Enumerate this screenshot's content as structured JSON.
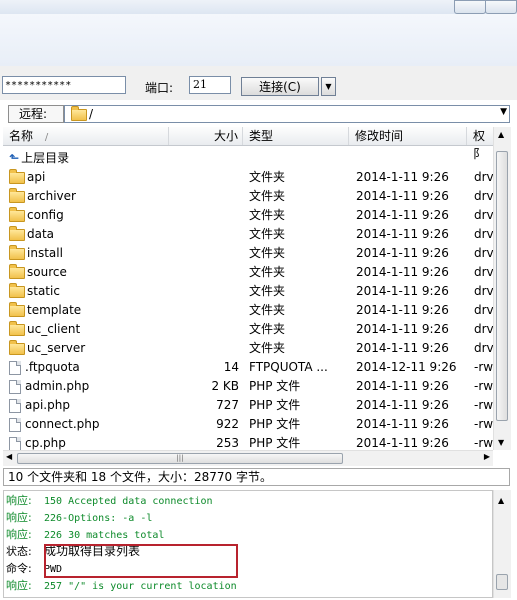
{
  "connection": {
    "password_mask": "***********",
    "port_label": "端口:",
    "port_value": "21",
    "connect_label": "连接(C)"
  },
  "remote": {
    "label": "远程:",
    "path": "/"
  },
  "columns": {
    "name": "名称",
    "size": "大小",
    "type": "类型",
    "modified": "修改时间",
    "perms": "权阝"
  },
  "rows": [
    {
      "name": "上层目录",
      "size": "",
      "type": "",
      "mod": "",
      "perm": "",
      "icon": "up-icon"
    },
    {
      "name": "api",
      "size": "",
      "type": "文件夹",
      "mod": "2014-1-11 9:26",
      "perm": "drv",
      "icon": "folder-icon"
    },
    {
      "name": "archiver",
      "size": "",
      "type": "文件夹",
      "mod": "2014-1-11 9:26",
      "perm": "drv",
      "icon": "folder-icon"
    },
    {
      "name": "config",
      "size": "",
      "type": "文件夹",
      "mod": "2014-1-11 9:26",
      "perm": "drv",
      "icon": "folder-icon"
    },
    {
      "name": "data",
      "size": "",
      "type": "文件夹",
      "mod": "2014-1-11 9:26",
      "perm": "drv",
      "icon": "folder-icon"
    },
    {
      "name": "install",
      "size": "",
      "type": "文件夹",
      "mod": "2014-1-11 9:26",
      "perm": "drv",
      "icon": "folder-icon"
    },
    {
      "name": "source",
      "size": "",
      "type": "文件夹",
      "mod": "2014-1-11 9:26",
      "perm": "drv",
      "icon": "folder-icon"
    },
    {
      "name": "static",
      "size": "",
      "type": "文件夹",
      "mod": "2014-1-11 9:26",
      "perm": "drv",
      "icon": "folder-icon"
    },
    {
      "name": "template",
      "size": "",
      "type": "文件夹",
      "mod": "2014-1-11 9:26",
      "perm": "drv",
      "icon": "folder-icon"
    },
    {
      "name": "uc_client",
      "size": "",
      "type": "文件夹",
      "mod": "2014-1-11 9:26",
      "perm": "drv",
      "icon": "folder-icon"
    },
    {
      "name": "uc_server",
      "size": "",
      "type": "文件夹",
      "mod": "2014-1-11 9:26",
      "perm": "drv",
      "icon": "folder-icon"
    },
    {
      "name": ".ftpquota",
      "size": "14",
      "type": "FTPQUOTA ...",
      "mod": "2014-12-11 9:26",
      "perm": "-rw",
      "icon": "file-icon"
    },
    {
      "name": "admin.php",
      "size": "2 KB",
      "type": "PHP 文件",
      "mod": "2014-1-11 9:26",
      "perm": "-rw",
      "icon": "file-icon"
    },
    {
      "name": "api.php",
      "size": "727",
      "type": "PHP 文件",
      "mod": "2014-1-11 9:26",
      "perm": "-rw",
      "icon": "file-icon"
    },
    {
      "name": "connect.php",
      "size": "922",
      "type": "PHP 文件",
      "mod": "2014-1-11 9:26",
      "perm": "-rw",
      "icon": "file-icon"
    },
    {
      "name": "cp.php",
      "size": "253",
      "type": "PHP 文件",
      "mod": "2014-1-11 9:26",
      "perm": "-rw",
      "icon": "file-icon"
    }
  ],
  "status_text": "10 个文件夹和 18 个文件，大小：28770 字节。",
  "log": [
    {
      "label": "响应:",
      "text": "150 Accepted data connection",
      "kind": "resp"
    },
    {
      "label": "响应:",
      "text": "226-Options: -a -l",
      "kind": "resp"
    },
    {
      "label": "响应:",
      "text": "226 30 matches total",
      "kind": "resp"
    },
    {
      "label": "状态:",
      "text": "成功取得目录列表",
      "kind": "stat"
    },
    {
      "label": "命令:",
      "text": "PWD",
      "kind": "cmd"
    },
    {
      "label": "响应:",
      "text": "257 \"/\" is your current location",
      "kind": "resp"
    }
  ],
  "colors": {
    "response": "#0d8a2a",
    "highlight_box": "#b8232e"
  }
}
